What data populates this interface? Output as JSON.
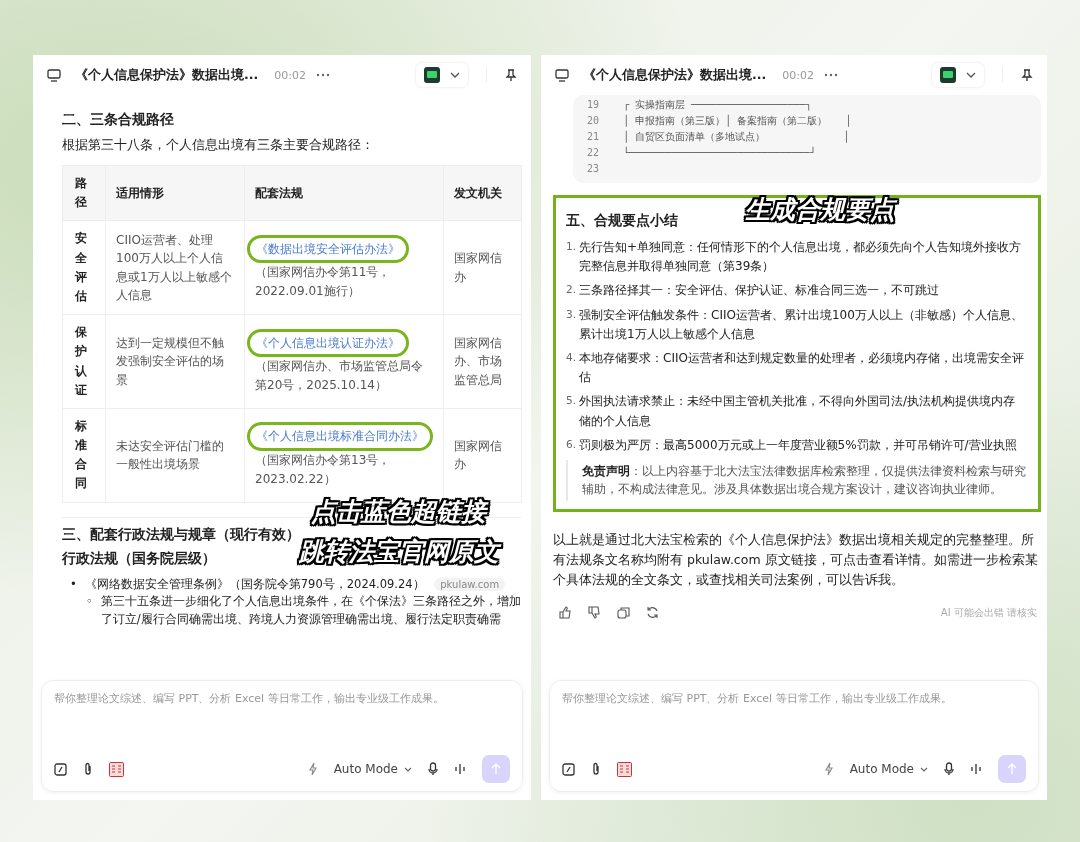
{
  "left_window": {
    "header": {
      "title": "《个人信息保护法》数据出境...",
      "time": "00:02"
    },
    "section_heading": "二、三条合规路径",
    "intro": "根据第三十八条，个人信息出境有三条主要合规路径：",
    "table": {
      "columns": [
        "路径",
        "适用情形",
        "配套法规",
        "发文机关"
      ],
      "rows": [
        {
          "path": "安全评估",
          "scenario": "CIIO运营者、处理100万人以上个人信息或1万人以上敏感个人信息",
          "regulation": {
            "link": "《数据出境安全评估办法》",
            "circled": true,
            "note": "（国家网信办令第11号，2022.09.01施行）"
          },
          "issuer": "国家网信办"
        },
        {
          "path": "保护认证",
          "scenario": "达到一定规模但不触发强制安全评估的场景",
          "regulation": {
            "link": "《个人信息出境认证办法》",
            "circled": true,
            "note": "（国家网信办、市场监管总局令第20号，2025.10.14）"
          },
          "issuer": "国家网信办、市场监管总局"
        },
        {
          "path": "标准合同",
          "scenario": "未达安全评估门槛的一般性出境场景",
          "regulation": {
            "link": "《个人信息出境标准合同办法》",
            "circled": true,
            "note": "（国家网信办令第13号，2023.02.22）"
          },
          "issuer": "国家网信办"
        }
      ]
    },
    "section_heading_2": "三、配套行政法规与规章（现行有效）",
    "subheading": "行政法规（国务院层级）",
    "bullets": [
      {
        "marker": "•",
        "text": "《网络数据安全管理条例》（国务院令第790号，2024.09.24）",
        "source_badge": "pkulaw.com",
        "children": [
          {
            "marker": "◦",
            "text": "第三十五条进一步细化了个人信息出境条件，在《个保法》三条路径之外，增加了订立/履行合同确需出境、跨境人力资源管理确需出境、履行法定职责确需"
          }
        ]
      }
    ],
    "annotations": [
      {
        "text": "点击蓝色超链接"
      },
      {
        "text": "跳转法宝官网原文"
      }
    ],
    "composer": {
      "placeholder": "帮你整理论文综述、编写 PPT、分析 Excel 等日常工作，输出专业级工作成果。",
      "mode": "Auto Mode"
    }
  },
  "right_window": {
    "header": {
      "title": "《个人信息保护法》数据出境...",
      "time": "00:02"
    },
    "code_block": {
      "lines": [
        {
          "number": "19",
          "text": "┌ 实操指南层 ───────────────────┐"
        },
        {
          "number": "20",
          "text": "│ 申报指南（第三版）│ 备案指南（第二版）   │"
        },
        {
          "number": "21",
          "text": "│ 自贸区负面清单（多地试点）             │"
        },
        {
          "number": "22",
          "text": "└──────────────────────────────┘"
        },
        {
          "number": "23"
        }
      ]
    },
    "annotation": "生成合规要点",
    "summary": {
      "heading": "五、合规要点小结",
      "highlighted": true,
      "items": [
        {
          "number": "1.",
          "text": "先行告知+单独同意：任何情形下的个人信息出境，都必须先向个人告知境外接收方完整信息并取得单独同意（第39条）"
        },
        {
          "number": "2.",
          "text": "三条路径择其一：安全评估、保护认证、标准合同三选一，不可跳过"
        },
        {
          "number": "3.",
          "text": "强制安全评估触发条件：CIIO运营者、累计出境100万人以上（非敏感）个人信息、累计出境1万人以上敏感个人信息"
        },
        {
          "number": "4.",
          "text": "本地存储要求：CIIO运营者和达到规定数量的处理者，必须境内存储，出境需安全评估"
        },
        {
          "number": "5.",
          "text": "外国执法请求禁止：未经中国主管机关批准，不得向外国司法/执法机构提供境内存储的个人信息"
        },
        {
          "number": "6.",
          "text": "罚则极为严厉：最高5000万元或上一年度营业额5%罚款，并可吊销许可/营业执照"
        }
      ],
      "disclaimer": "**免责声明**：以上内容基于北大法宝法律数据库检索整理，仅提供法律资料检索与研究辅助，不构成法律意见。涉及具体数据出境合规方案设计，建议咨询执业律师。"
    },
    "closing": "以上就是通过北大法宝检索的《个人信息保护法》数据出境相关规定的完整整理。所有法规条文名称均附有 pkulaw.com 原文链接，可点击查看详情。如需进一步检索某个具体法规的全文条文，或查找相关司法案例，可以告诉我。",
    "ai_notice": "AI 可能会出错 请核实",
    "composer": {
      "placeholder": "帮你整理论文综述、编写 PPT、分析 Excel 等日常工作，输出专业级工作成果。",
      "mode": "Auto Mode"
    }
  }
}
